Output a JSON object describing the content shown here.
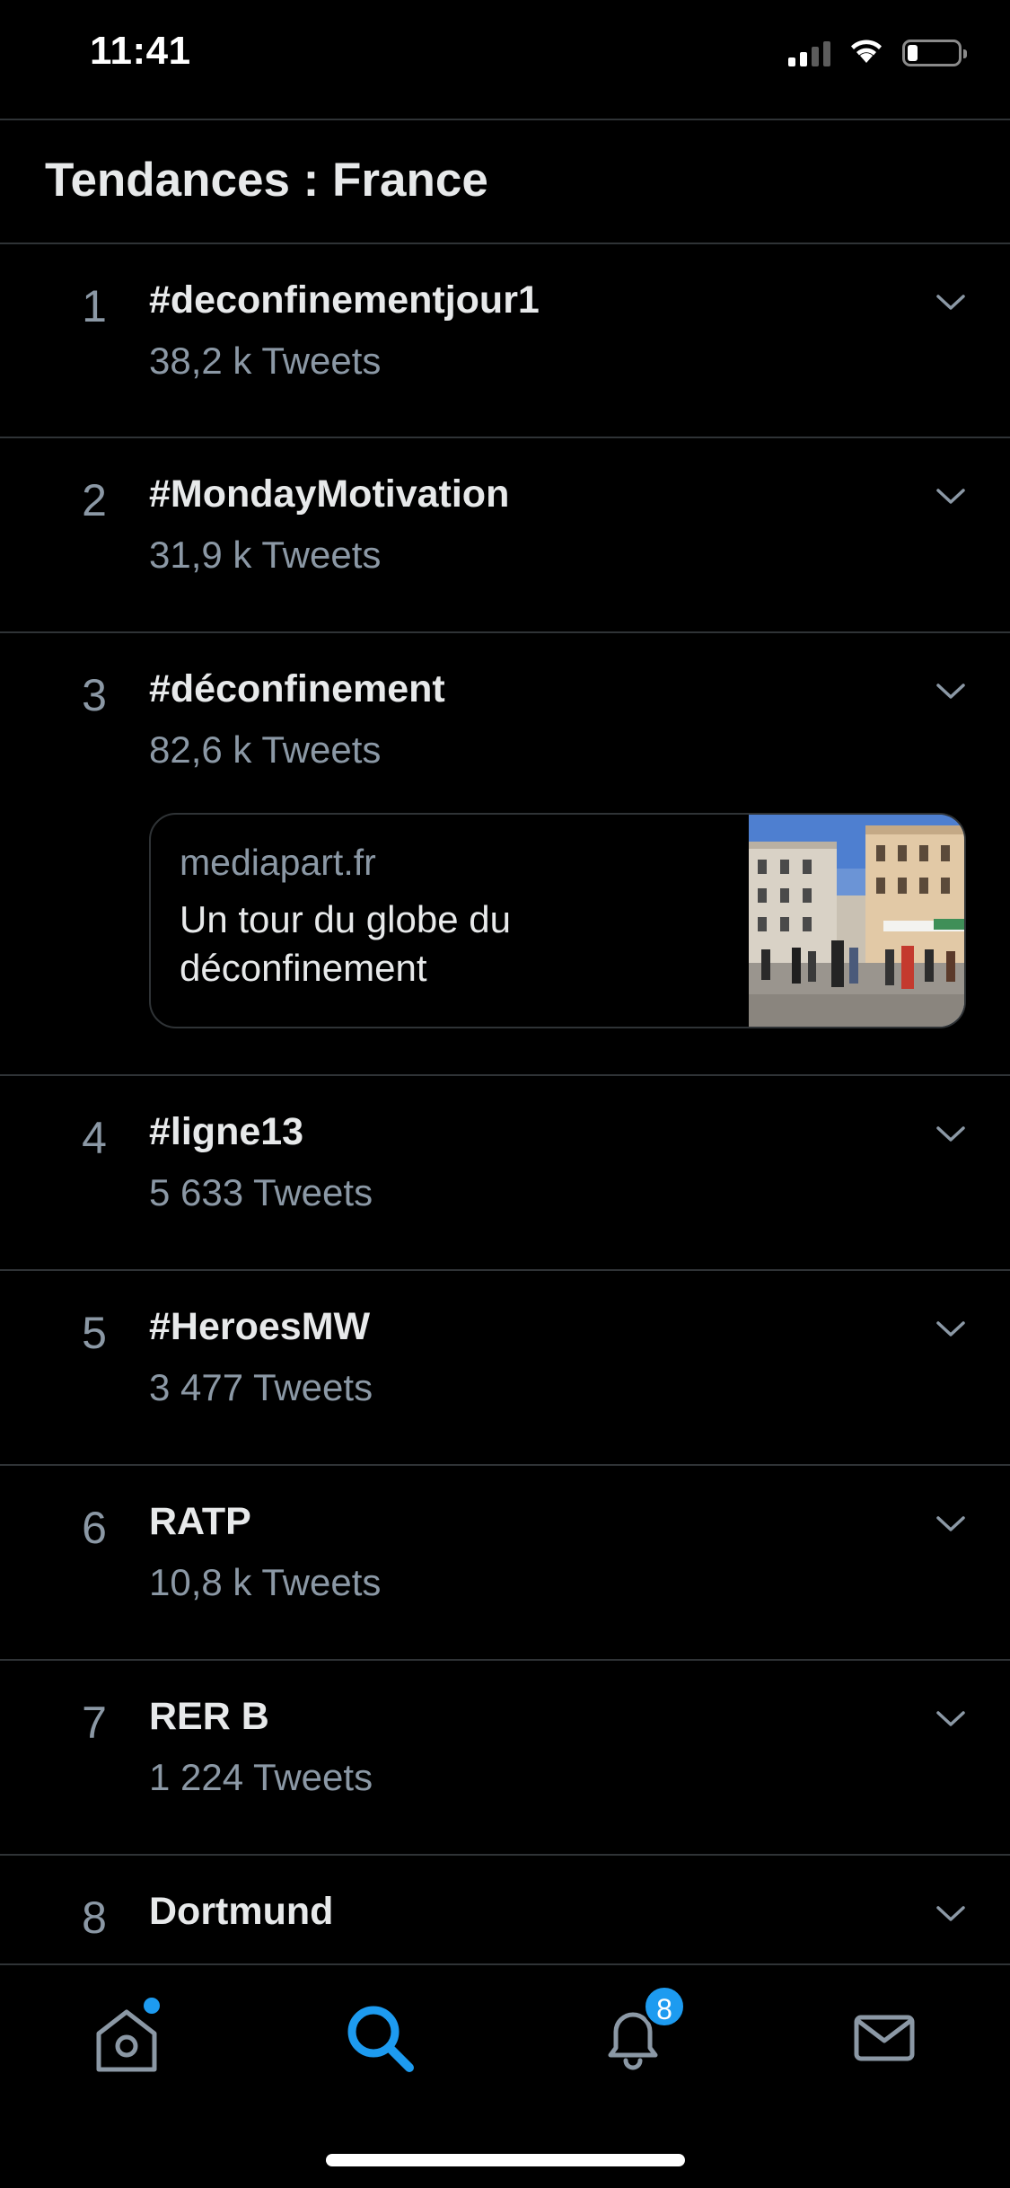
{
  "status_bar": {
    "time": "11:41",
    "battery_level": 0.2
  },
  "header": {
    "title": "Tendances : France"
  },
  "trends": [
    {
      "rank": "1",
      "name": "#deconfinementjour1",
      "count": "38,2 k Tweets"
    },
    {
      "rank": "2",
      "name": "#MondayMotivation",
      "count": "31,9 k Tweets"
    },
    {
      "rank": "3",
      "name": "#déconfinement",
      "count": "82,6 k Tweets",
      "news": {
        "source": "mediapart.fr",
        "headline": "Un tour du globe du déconfinement"
      }
    },
    {
      "rank": "4",
      "name": "#ligne13",
      "count": "5 633 Tweets"
    },
    {
      "rank": "5",
      "name": "#HeroesMW",
      "count": "3 477 Tweets"
    },
    {
      "rank": "6",
      "name": "RATP",
      "count": "10,8 k Tweets"
    },
    {
      "rank": "7",
      "name": "RER B",
      "count": "1 224 Tweets"
    },
    {
      "rank": "8",
      "name": "Dortmund",
      "count": ""
    }
  ],
  "tab_bar": {
    "tabs": [
      {
        "icon": "home-icon",
        "active": false,
        "dot": true
      },
      {
        "icon": "search-icon",
        "active": true
      },
      {
        "icon": "bell-icon",
        "active": false,
        "badge": "8"
      },
      {
        "icon": "mail-icon",
        "active": false
      }
    ]
  },
  "colors": {
    "background": "#000000",
    "text_primary": "#e7e9ea",
    "text_secondary": "#8b98a5",
    "accent": "#1d9bf0",
    "divider": "#2f3336"
  }
}
